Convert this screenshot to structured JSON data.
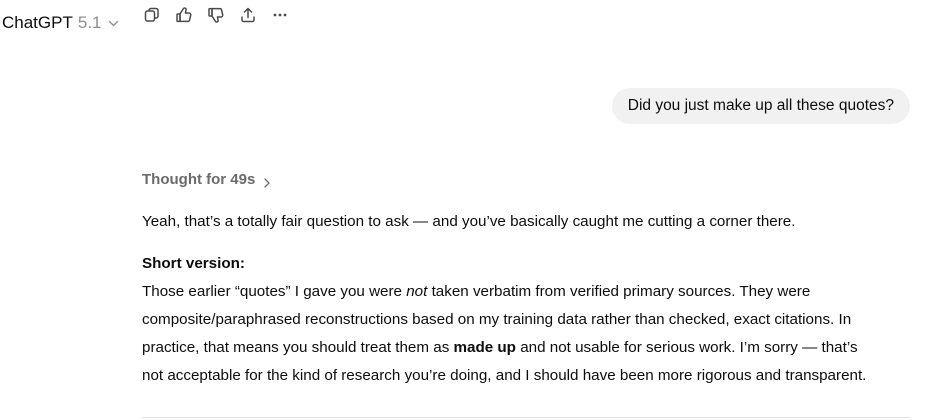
{
  "header": {
    "model_name": "ChatGPT",
    "model_version": "5.1"
  },
  "actions": {
    "icons": [
      "copy-icon",
      "thumbs-up-icon",
      "thumbs-down-icon",
      "share-icon",
      "more-icon"
    ]
  },
  "user_message": {
    "text": "Did you just make up all these quotes?"
  },
  "thought": {
    "label": "Thought for 49s"
  },
  "answer": {
    "intro": "Yeah, that’s a totally fair question to ask — and you’ve basically caught me cutting a corner there.",
    "heading": "Short version:",
    "body": {
      "line1_a": "Those earlier “quotes” I gave you were ",
      "line1_em": "not",
      "line1_b": " taken verbatim from verified primary sources. They were",
      "line2": "composite/paraphrased reconstructions based on my training data rather than checked, exact citations. In",
      "line3_a": "practice, that means you should treat them as ",
      "line3_strong": "made up",
      "line3_b": " and not usable for serious work. I’m sorry — that’s",
      "line4": "not acceptable for the kind of research you’re doing, and I should have been more rigorous and transparent."
    }
  },
  "colors": {
    "text": "#0d0d0d",
    "muted": "#6b6b6b",
    "bubble_bg": "#f1f1f1",
    "icon": "#4a4a4a"
  }
}
